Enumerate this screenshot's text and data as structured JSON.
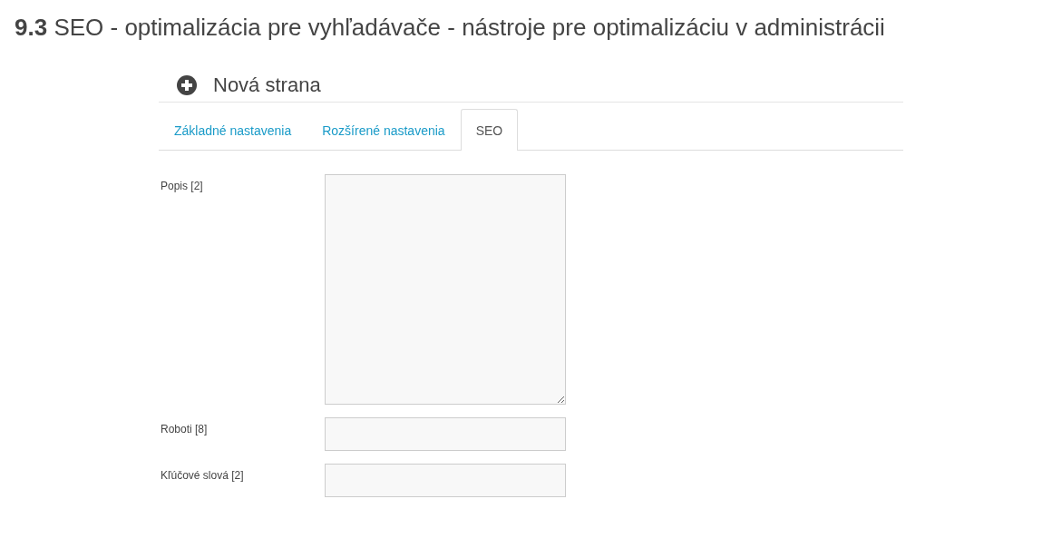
{
  "heading": "**9.3** SEO - optimalizácia pre vyhľadávače - nástroje pre optimalizáciu v administrácii",
  "panel": {
    "title": "Nová strana",
    "tabs": [
      {
        "label": "Základné nastavenia",
        "selected": false
      },
      {
        "label": "Rozšírené nastavenia",
        "selected": false
      },
      {
        "label": "SEO",
        "selected": true
      }
    ],
    "fields": [
      {
        "label": "Popis [2]",
        "kind": "textarea"
      },
      {
        "label": "Roboti [8]",
        "kind": "input"
      },
      {
        "label": "Kľúčové slová [2]",
        "kind": "input"
      }
    ]
  }
}
